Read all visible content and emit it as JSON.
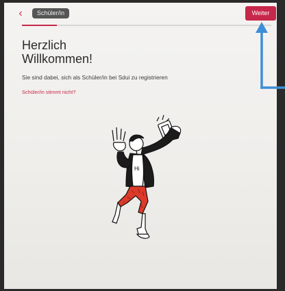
{
  "header": {
    "back_icon": "chevron-left-icon",
    "role_chip": "Schüler/in",
    "next_button": "Weiter",
    "progress_fraction": 0.14
  },
  "main": {
    "title_line1": "Herzlich",
    "title_line2": "Willkommen!",
    "subtitle": "Sie sind dabei, sich als Schüler/in bei Sdui zu registrieren",
    "wrong_role_link": "Schüler/in stimmt nicht?",
    "illustration_text": "Hi"
  },
  "colors": {
    "accent": "#c6274a",
    "annotation_arrow": "#3d8ed6",
    "chip_bg": "#555555"
  }
}
